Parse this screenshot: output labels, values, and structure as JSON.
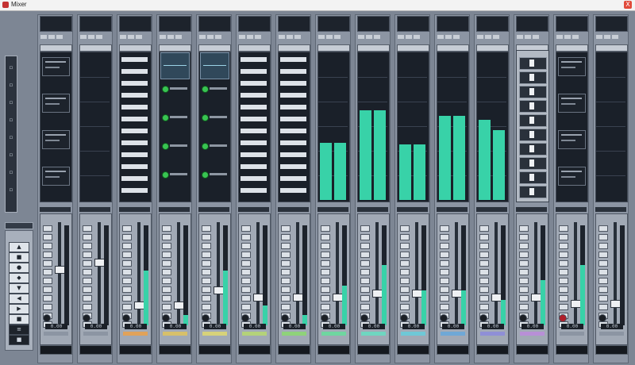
{
  "window": {
    "title": "Mixer",
    "close_label": "X"
  },
  "toolbox": {
    "top_icons": [
      "arrow-icon",
      "range-icon",
      "scissors-icon",
      "pencil-icon",
      "eraser-icon",
      "zoom-icon",
      "mute-icon",
      "speaker-icon"
    ],
    "bottom_buttons": [
      "▲",
      "■",
      "●",
      "◆",
      "▼",
      "◀",
      "▶",
      "■",
      "≡",
      "■"
    ]
  },
  "strips": [
    {
      "name": "",
      "header": [
        "",
        ""
      ],
      "fx": "inserts",
      "vu": [
        0.0,
        0.0
      ],
      "fader": 0.55,
      "value": "0.00",
      "tag": "#8c95a3",
      "rec": false
    },
    {
      "name": "",
      "header": [
        "",
        ""
      ],
      "fx": "meter",
      "vu": [
        0.0,
        0.0
      ],
      "fader": 0.62,
      "value": "0.00",
      "tag": "#8c95a3",
      "rec": false
    },
    {
      "name": "",
      "header": [
        "",
        ""
      ],
      "fx": "rows",
      "vu": [
        0.55,
        0.05
      ],
      "fader": 0.18,
      "value": "0.00",
      "tag": "#e0a25a",
      "rec": false
    },
    {
      "name": "",
      "header": [
        "",
        ""
      ],
      "fx": "eq",
      "vu": [
        0.1,
        0.05
      ],
      "fader": 0.18,
      "value": "0.00",
      "tag": "#d7c06a",
      "rec": false
    },
    {
      "name": "",
      "header": [
        "",
        ""
      ],
      "fx": "eq",
      "vu": [
        0.55,
        0.05
      ],
      "fader": 0.34,
      "value": "0.00",
      "tag": "#d7d27a",
      "rec": false
    },
    {
      "name": "",
      "header": [
        "",
        ""
      ],
      "fx": "rows",
      "vu": [
        0.2,
        0.05
      ],
      "fader": 0.26,
      "value": "0.00",
      "tag": "#b4d27a",
      "rec": false
    },
    {
      "name": "",
      "header": [
        "",
        ""
      ],
      "fx": "rows",
      "vu": [
        0.1,
        0.05
      ],
      "fader": 0.26,
      "value": "0.00",
      "tag": "#8fd27a",
      "rec": false
    },
    {
      "name": "",
      "header": [
        "",
        ""
      ],
      "fx": "green",
      "vu": [
        0.4,
        0.05
      ],
      "fader": 0.26,
      "value": "0.00",
      "tag": "#6fd6a0",
      "rec": false
    },
    {
      "name": "",
      "header": [
        "",
        ""
      ],
      "fx": "green",
      "vu": [
        0.6,
        0.05
      ],
      "fader": 0.3,
      "value": "0.00",
      "tag": "#6fd6c0",
      "rec": false
    },
    {
      "name": "",
      "header": [
        "",
        ""
      ],
      "fx": "green",
      "vu": [
        0.35,
        0.05
      ],
      "fader": 0.3,
      "value": "0.00",
      "tag": "#6fc8d6",
      "rec": false
    },
    {
      "name": "",
      "header": [
        "",
        ""
      ],
      "fx": "green",
      "vu": [
        0.35,
        0.05
      ],
      "fader": 0.3,
      "value": "0.00",
      "tag": "#6fa8d6",
      "rec": false
    },
    {
      "name": "",
      "header": [
        "",
        ""
      ],
      "fx": "green",
      "vu": [
        0.25,
        0.05
      ],
      "fader": 0.26,
      "value": "0.00",
      "tag": "#8f8fd6",
      "rec": false
    },
    {
      "name": "",
      "header": [
        "",
        ""
      ],
      "fx": "vst",
      "vu": [
        0.45,
        0.05
      ],
      "fader": 0.26,
      "value": "0.00",
      "tag": "#b88fd6",
      "rec": false
    },
    {
      "name": "",
      "header": [
        "",
        ""
      ],
      "fx": "inserts",
      "vu": [
        0.6,
        0.05
      ],
      "fader": 0.2,
      "value": "0.00",
      "tag": "#8c95a3",
      "rec": true
    },
    {
      "name": "",
      "header": [
        "",
        ""
      ],
      "fx": "meter",
      "vu": [
        0.0,
        0.0
      ],
      "fader": 0.2,
      "value": "0.00",
      "tag": "#8c95a3",
      "rec": false
    }
  ],
  "meter_levels": [
    {
      "l": 0.0,
      "r": 0.0
    },
    {
      "l": 0.0,
      "r": 0.0
    },
    {
      "l": 0.0,
      "r": 0.0
    },
    {
      "l": 0.0,
      "r": 0.0
    },
    {
      "l": 0.0,
      "r": 0.0
    },
    {
      "l": 0.0,
      "r": 0.0
    },
    {
      "l": 0.0,
      "r": 0.0
    },
    {
      "l": 0.4,
      "r": 0.4
    },
    {
      "l": 0.63,
      "r": 0.63
    },
    {
      "l": 0.39,
      "r": 0.39
    },
    {
      "l": 0.59,
      "r": 0.59
    },
    {
      "l": 0.56,
      "r": 0.49
    },
    {
      "l": 0.0,
      "r": 0.0
    },
    {
      "l": 0.0,
      "r": 0.0
    },
    {
      "l": 0.0,
      "r": 0.0
    }
  ],
  "colors": {
    "meter": "#38d2a8",
    "background": "#7d8694",
    "knob": "#39c452",
    "record": "#b01f2a"
  }
}
